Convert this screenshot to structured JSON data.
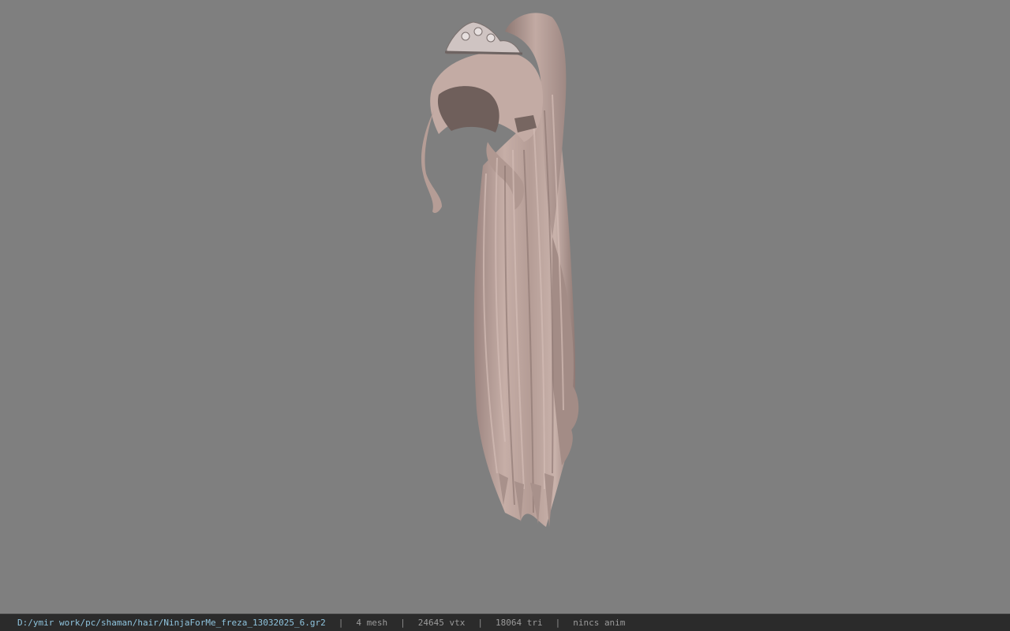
{
  "viewport": {
    "background": "#7f7f7f",
    "model": {
      "subject": "hair-ponytail-with-tiara",
      "hair_color": "#bfa7a0",
      "tiara_color": "#d8cfcd"
    }
  },
  "status_bar": {
    "file_path": "D:/ymir work/pc/shaman/hair/NinjaForMe_freza_13032025_6.gr2",
    "separator": "|",
    "mesh_count": "4 mesh",
    "vertex_count": "24645 vtx",
    "triangle_count": "18064 tri",
    "anim_status": "nincs anim",
    "path_color": "#8fc4de",
    "text_color": "#9a9a9a",
    "background": "#2b2b2b"
  }
}
